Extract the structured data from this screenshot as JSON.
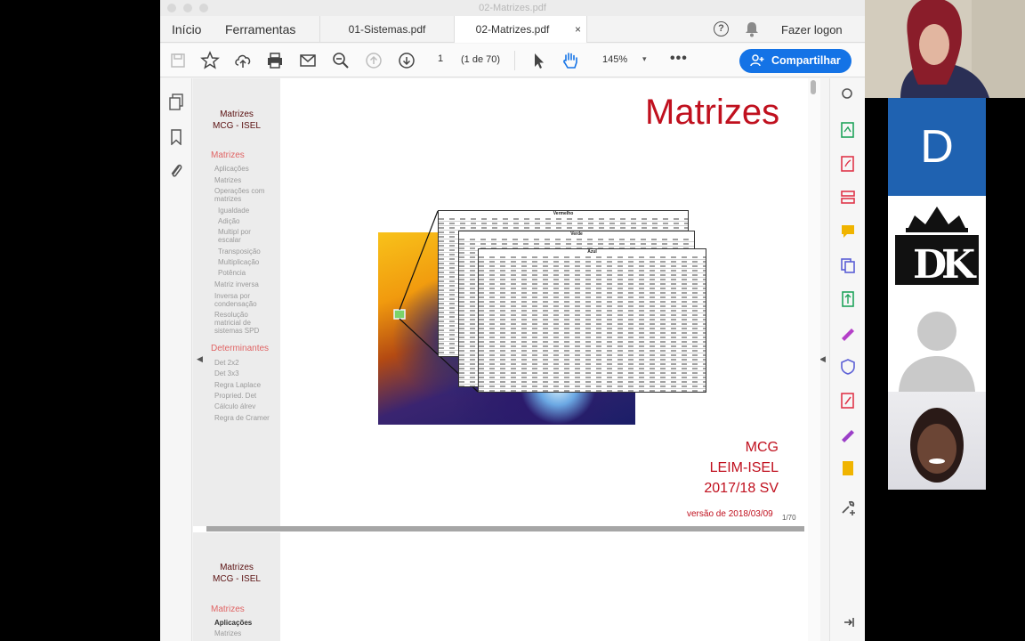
{
  "window": {
    "title": "02-Matrizes.pdf"
  },
  "nav": {
    "home": "Início",
    "tools": "Ferramentas"
  },
  "tabs": [
    {
      "label": "01-Sistemas.pdf"
    },
    {
      "label": "02-Matrizes.pdf",
      "close": "×"
    }
  ],
  "account": {
    "login": "Fazer logon"
  },
  "toolbar": {
    "page_value": "1",
    "page_count": "(1 de 70)",
    "zoom": "145%",
    "zoom_caret": "▾",
    "more": "•••",
    "share_label": "Compartilhar"
  },
  "side_arrows": {
    "left": "◀",
    "right": "◀"
  },
  "accent_color": "#1473e6",
  "slide": {
    "side_title_1": "Matrizes",
    "side_title_2": "MCG - ISEL",
    "section_matrizes": "Matrizes",
    "items_matrizes": [
      "Aplicações",
      "Matrizes",
      "Operações com",
      "matrizes",
      "Igualdade",
      "Adição",
      "Multipl por",
      "escalar",
      "Transposição",
      "Multiplicação",
      "Potência",
      "Matriz inversa",
      "Inversa por",
      "condensação",
      "Resolução",
      "matricial de",
      "sistemas SPD"
    ],
    "section_determinantes": "Determinantes",
    "items_determinantes": [
      "Det 2x2",
      "Det 3x3",
      "Regra Laplace",
      "Propried. Det",
      "Cálculo álrev",
      "Regra de Cramer"
    ],
    "title": "Matrizes",
    "author_1": "MCG",
    "author_2": "LEIM-ISEL",
    "author_3": "2017/18 SV",
    "version": "versão de 2018/03/09",
    "page_number": "1/70",
    "table_titles": [
      "Vermelho",
      "Verde",
      "Azul"
    ]
  },
  "slide2": {
    "side_title_1": "Matrizes",
    "side_title_2": "MCG - ISEL",
    "section": "Matrizes",
    "item_1": "Aplicações",
    "item_2": "Matrizes"
  },
  "call": {
    "tile_letter": "D"
  }
}
